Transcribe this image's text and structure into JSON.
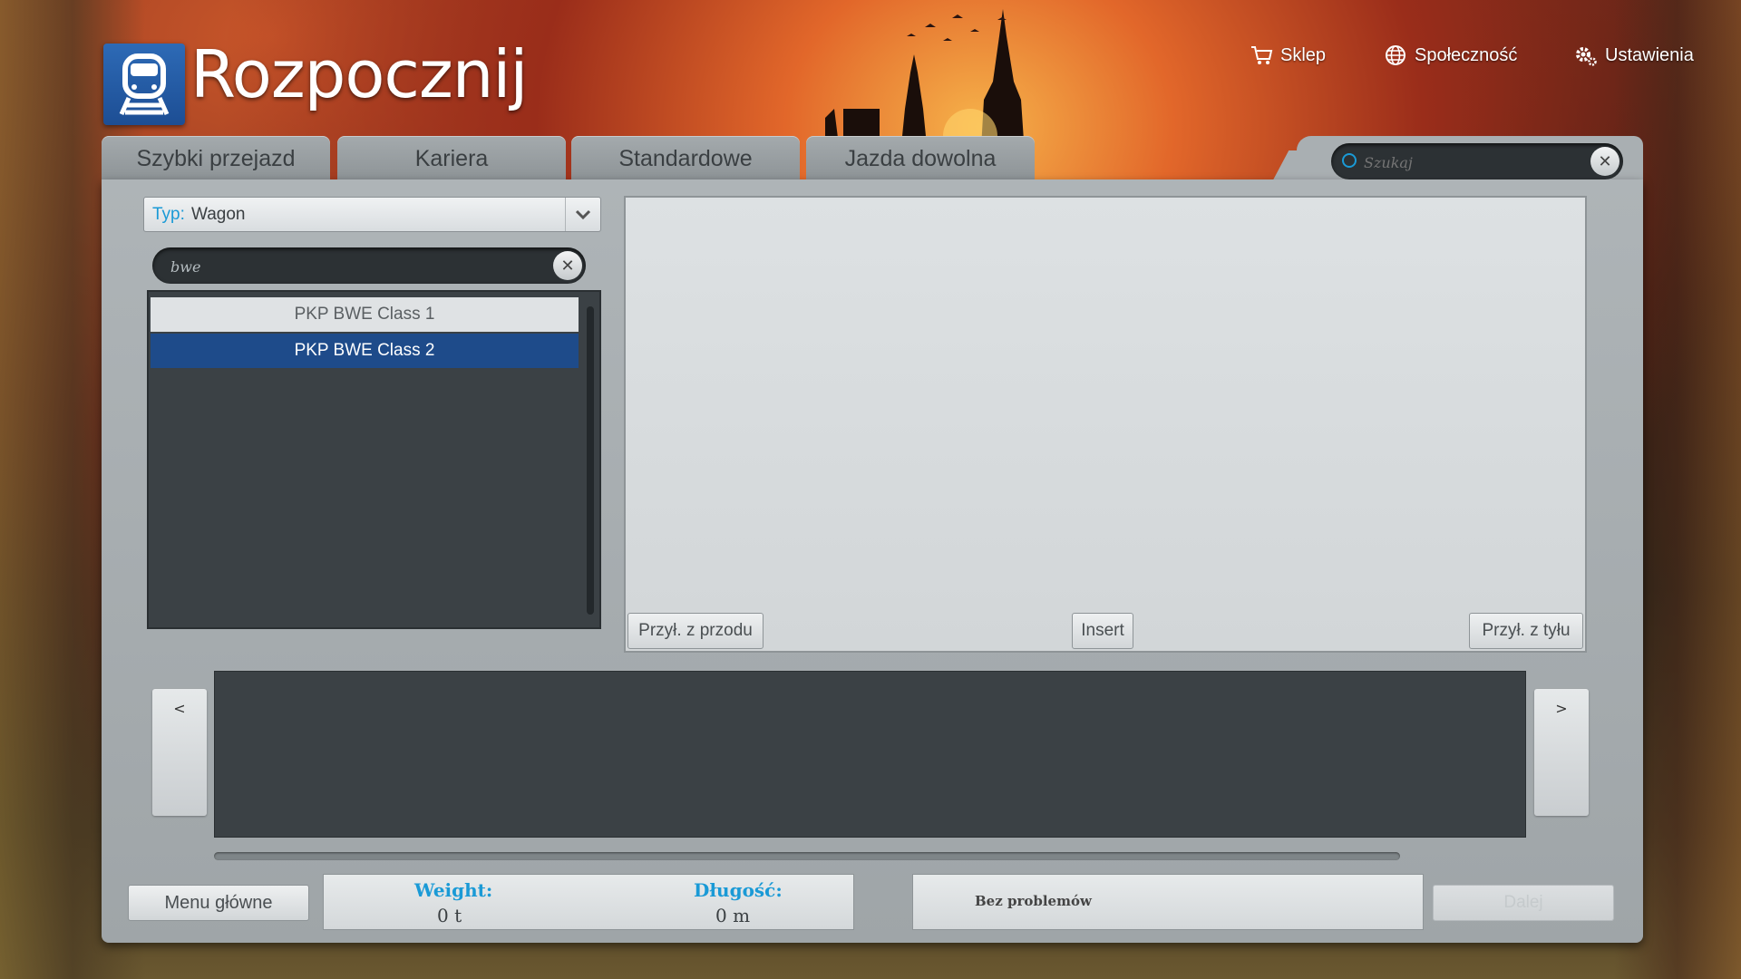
{
  "app": {
    "title": "Rozpocznij"
  },
  "topnav": [
    {
      "label": "Sklep",
      "icon": "cart-icon"
    },
    {
      "label": "Społeczność",
      "icon": "globe-icon"
    },
    {
      "label": "Ustawienia",
      "icon": "gear-icon"
    }
  ],
  "tabs": [
    {
      "label": "Szybki przejazd"
    },
    {
      "label": "Kariera"
    },
    {
      "label": "Standardowe"
    },
    {
      "label": "Jazda dowolna"
    }
  ],
  "search": {
    "placeholder": "Szukaj",
    "value": ""
  },
  "filter": {
    "type_label": "Typ:",
    "type_value": "Wagon"
  },
  "list_search": {
    "value": "bwe"
  },
  "list": {
    "items": [
      {
        "label": "PKP BWE Class 1",
        "selected": false
      },
      {
        "label": "PKP BWE Class 2",
        "selected": true
      }
    ]
  },
  "preview": {
    "front_button": "Przył. z przodu",
    "insert_button": "Insert",
    "back_button": "Przył. z tyłu"
  },
  "strip": {
    "prev": "<",
    "next": ">"
  },
  "footer": {
    "menu_button": "Menu główne",
    "weight_label": "Weight:",
    "weight_value": "0 t",
    "length_label": "Długość:",
    "length_value": "0 m",
    "status": "Bez problemów",
    "next_button": "Dalej"
  },
  "colors": {
    "accent": "#1a9ad6",
    "selected": "#1e4b8a",
    "logo": "#2d6ab6"
  }
}
